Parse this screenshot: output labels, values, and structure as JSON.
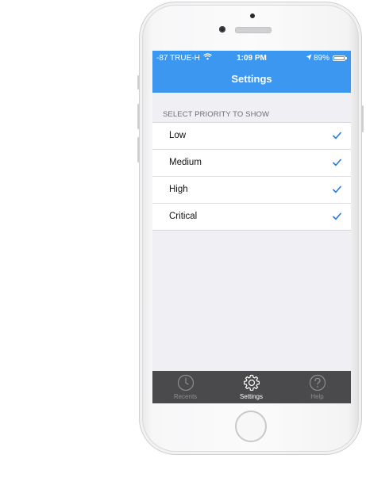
{
  "status_bar": {
    "carrier": "-87 TRUE-H",
    "time": "1:09 PM",
    "battery": "89%"
  },
  "nav": {
    "title": "Settings"
  },
  "section": {
    "header": "SELECT PRIORITY TO SHOW"
  },
  "priorities": [
    {
      "label": "Low",
      "checked": true
    },
    {
      "label": "Medium",
      "checked": true
    },
    {
      "label": "High",
      "checked": true
    },
    {
      "label": "Critical",
      "checked": true
    }
  ],
  "tabs": [
    {
      "label": "Recents",
      "icon": "clock-icon",
      "active": false
    },
    {
      "label": "Settings",
      "icon": "gear-icon",
      "active": true
    },
    {
      "label": "Help",
      "icon": "question-icon",
      "active": false
    }
  ],
  "colors": {
    "accent": "#3b97f0",
    "check": "#1f7ce8",
    "tab_bar": "#4a4a4c",
    "background": "#efeff4"
  }
}
